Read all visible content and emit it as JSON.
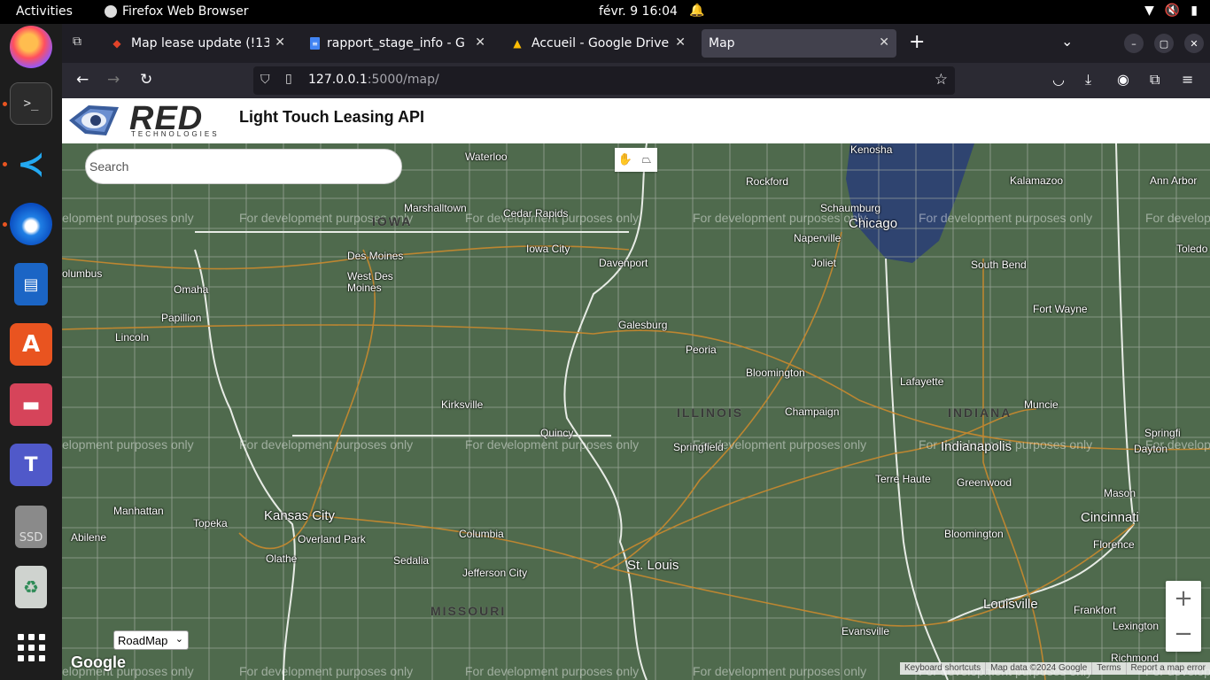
{
  "topbar": {
    "activities": "Activities",
    "app_name": "Firefox Web Browser",
    "clock": "févr. 9  16:04"
  },
  "dock": {
    "apps": [
      "firefox-icon",
      "terminal-icon",
      "vscode-icon",
      "thunderbird-icon",
      "writer-icon",
      "app-center-icon",
      "files-icon",
      "teams-icon",
      "ssd-drive-icon",
      "trash-icon",
      "show-apps-icon"
    ],
    "ssd_label": "SSD"
  },
  "tabs": [
    {
      "title": "Map lease update (!13) · N",
      "icon": "gitlab-icon",
      "active": false
    },
    {
      "title": "rapport_stage_info - Goo",
      "icon": "google-docs-icon",
      "active": false
    },
    {
      "title": "Accueil - Google Drive",
      "icon": "google-drive-icon",
      "active": false
    },
    {
      "title": "Map",
      "icon": "none",
      "active": true
    }
  ],
  "address": {
    "host": "127.0.0.1",
    "path": ":5000/map/"
  },
  "app": {
    "logo_text": "RED",
    "logo_sub": "TECHNOLOGIES",
    "title": "Light Touch Leasing API"
  },
  "map": {
    "search_placeholder": "Search",
    "maptype": "RoadMap",
    "watermark": "For development purposes only",
    "watermark_left_cut": "elopment purposes only",
    "google_logo": "Google",
    "attribution": [
      "Keyboard shortcuts",
      "Map data ©2024 Google",
      "Terms",
      "Report a map error"
    ],
    "zoom_in": "+",
    "zoom_out": "−",
    "cities": {
      "waterloo": "Waterloo",
      "rockford": "Rockford",
      "kenosha": "Kenosha",
      "kalamazoo": "Kalamazoo",
      "ann_arbor": "Ann Arbor",
      "marshalltown": "Marshalltown",
      "cedar_rapids": "Cedar Rapids",
      "schaumburg": "Schaumburg",
      "chicago": "Chicago",
      "naperville": "Naperville",
      "iowa_city": "Iowa City",
      "davenport": "Davenport",
      "joliet": "Joliet",
      "south_bend": "South Bend",
      "toledo": "Toledo",
      "des_moines": "Des Moines",
      "west_des_moines": "West Des Moines",
      "columbus": "olumbus",
      "omaha": "Omaha",
      "papillion": "Papillion",
      "fort_wayne": "Fort Wayne",
      "galesburg": "Galesburg",
      "lincoln": "Lincoln",
      "peoria": "Peoria",
      "bloomington": "Bloomington",
      "kirksville": "Kirksville",
      "lafayette": "Lafayette",
      "champaign": "Champaign",
      "muncie": "Muncie",
      "quincy": "Quincy",
      "springfield": "Springfield",
      "indianapolis": "Indianapolis",
      "dayton": "Dayton",
      "terre_haute": "Terre Haute",
      "greenwood": "Greenwood",
      "manhattan": "Manhattan",
      "topeka": "Topeka",
      "kansas_city": "Kansas City",
      "overland_park": "Overland Park",
      "abilene": "Abilene",
      "olathe": "Olathe",
      "columbia": "Columbia",
      "sedalia": "Sedalia",
      "jefferson_city": "Jefferson City",
      "st_louis": "St. Louis",
      "bloomington_in": "Bloomington",
      "cincinnati": "Cincinnati",
      "mason": "Mason",
      "florence": "Florence",
      "louisville": "Louisville",
      "frankfort": "Frankfort",
      "lexington": "Lexington",
      "evansville": "Evansville",
      "richmond": "Richmond",
      "springfield_oh": "Springfi"
    },
    "states": {
      "iowa": "IOWA",
      "illinois": "ILLINOIS",
      "indiana": "INDIANA",
      "missouri": "MISSOURI"
    }
  }
}
